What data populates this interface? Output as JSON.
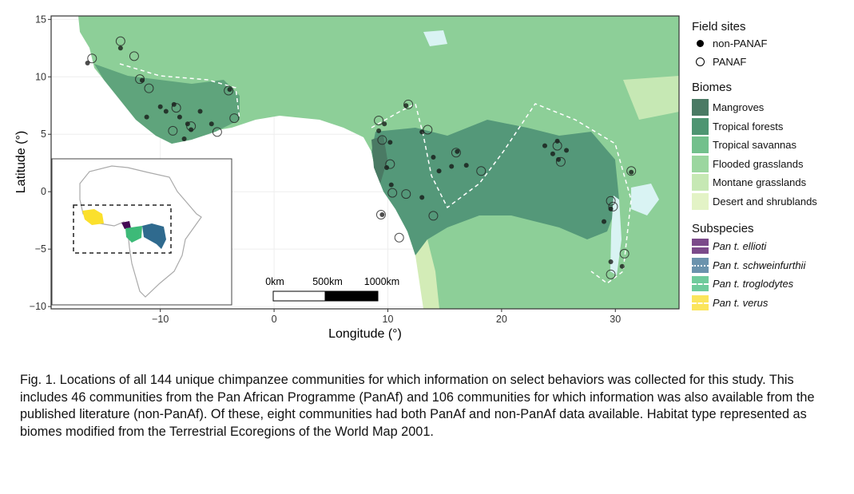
{
  "figure": {
    "caption": "Fig. 1. Locations of all 144 unique chimpanzee communities for which information on select behaviors was collected for this study. This includes 46 communities from the Pan African Programme (PanAf) and 106 communities for which information was also available from the published literature (non-PanAf). Of these, eight communities had both PanAf and non-PanAf data available. Habitat type represented as biomes modified from the Terrestrial Ecoregions of the World Map 2001."
  },
  "chart_data": {
    "type": "map",
    "xlabel": "Longitude (°)",
    "ylabel": "Latitude (°)",
    "xlim": [
      -19.6,
      35.6
    ],
    "ylim": [
      -10.2,
      15.3
    ],
    "xticks": [
      "−10",
      "0",
      "10",
      "20",
      "30"
    ],
    "xtick_values": [
      -10,
      0,
      10,
      20,
      30
    ],
    "yticks": [
      "15",
      "10",
      "5",
      "0",
      "−5",
      "−10"
    ],
    "ytick_values": [
      15,
      10,
      5,
      0,
      -5,
      -10
    ],
    "grid": true,
    "scale_bar": {
      "labels": [
        "0km",
        "500km",
        "1000km"
      ]
    },
    "legend": {
      "placement": "right",
      "field_sites_title": "Field sites",
      "field_sites": [
        {
          "label": "non-PANAF",
          "marker": "filled-circle"
        },
        {
          "label": "PANAF",
          "marker": "open-circle"
        }
      ],
      "biomes_title": "Biomes",
      "biomes": [
        {
          "label": "Mangroves",
          "color": "#4a7a64"
        },
        {
          "label": "Tropical forests",
          "color": "#4e9572"
        },
        {
          "label": "Tropical savannas",
          "color": "#72c08c"
        },
        {
          "label": "Flooded grasslands",
          "color": "#9bd69f"
        },
        {
          "label": "Montane grasslands",
          "color": "#c6e8b4"
        },
        {
          "label": "Desert and shrublands",
          "color": "#e3f3c6"
        }
      ],
      "subspecies_title": "Subspecies",
      "subspecies": [
        {
          "label": "Pan t. ellioti",
          "color": "#7b4a8a",
          "line": "solid"
        },
        {
          "label": "Pan t. schweinfurthii",
          "color": "#6b93ad",
          "line": "dotted"
        },
        {
          "label": "Pan t. troglodytes",
          "color": "#6fcb9c",
          "line": "dashed"
        },
        {
          "label": "Pan t. verus",
          "color": "#fbe55c",
          "line": "longdash"
        }
      ]
    },
    "sites_non_panaf": [
      [
        -16.4,
        11.2
      ],
      [
        -13.5,
        12.5
      ],
      [
        -11.6,
        9.7
      ],
      [
        -11.2,
        6.5
      ],
      [
        -10.0,
        7.4
      ],
      [
        -9.5,
        7.0
      ],
      [
        -8.8,
        7.6
      ],
      [
        -8.3,
        6.5
      ],
      [
        -7.6,
        5.9
      ],
      [
        -7.3,
        5.4
      ],
      [
        -7.9,
        4.6
      ],
      [
        -6.5,
        7.0
      ],
      [
        -3.9,
        8.9
      ],
      [
        -5.5,
        5.9
      ],
      [
        9.2,
        5.3
      ],
      [
        9.7,
        5.9
      ],
      [
        10.2,
        4.3
      ],
      [
        9.9,
        2.1
      ],
      [
        10.3,
        0.6
      ],
      [
        11.6,
        7.5
      ],
      [
        13.0,
        5.2
      ],
      [
        14.0,
        3.0
      ],
      [
        15.6,
        2.2
      ],
      [
        16.9,
        2.3
      ],
      [
        16.1,
        3.5
      ],
      [
        14.5,
        1.8
      ],
      [
        13.0,
        -0.5
      ],
      [
        9.5,
        -2.0
      ],
      [
        23.8,
        4.0
      ],
      [
        24.5,
        3.3
      ],
      [
        25.0,
        2.8
      ],
      [
        25.7,
        3.6
      ],
      [
        24.9,
        4.4
      ],
      [
        29.6,
        -1.5
      ],
      [
        29.0,
        -2.6
      ],
      [
        29.6,
        -6.1
      ],
      [
        30.6,
        -6.5
      ],
      [
        31.4,
        1.7
      ]
    ],
    "sites_panaf": [
      [
        -16.0,
        11.6
      ],
      [
        -13.5,
        13.1
      ],
      [
        -12.3,
        11.8
      ],
      [
        -11.8,
        9.8
      ],
      [
        -11.0,
        9.0
      ],
      [
        -8.6,
        7.3
      ],
      [
        -8.9,
        5.3
      ],
      [
        -7.3,
        5.7
      ],
      [
        -5.0,
        5.2
      ],
      [
        -4.0,
        8.8
      ],
      [
        -3.5,
        6.4
      ],
      [
        9.2,
        6.2
      ],
      [
        9.5,
        4.5
      ],
      [
        10.2,
        2.4
      ],
      [
        10.4,
        -0.1
      ],
      [
        11.8,
        7.6
      ],
      [
        13.5,
        5.4
      ],
      [
        16.0,
        3.4
      ],
      [
        18.2,
        1.8
      ],
      [
        14.0,
        -2.1
      ],
      [
        11.6,
        -0.2
      ],
      [
        9.4,
        -2.0
      ],
      [
        11.0,
        -4.0
      ],
      [
        24.9,
        4.0
      ],
      [
        25.2,
        2.6
      ],
      [
        29.6,
        -0.8
      ],
      [
        29.8,
        -1.3
      ],
      [
        30.8,
        -5.4
      ],
      [
        29.6,
        -7.2
      ],
      [
        31.4,
        1.8
      ]
    ]
  }
}
